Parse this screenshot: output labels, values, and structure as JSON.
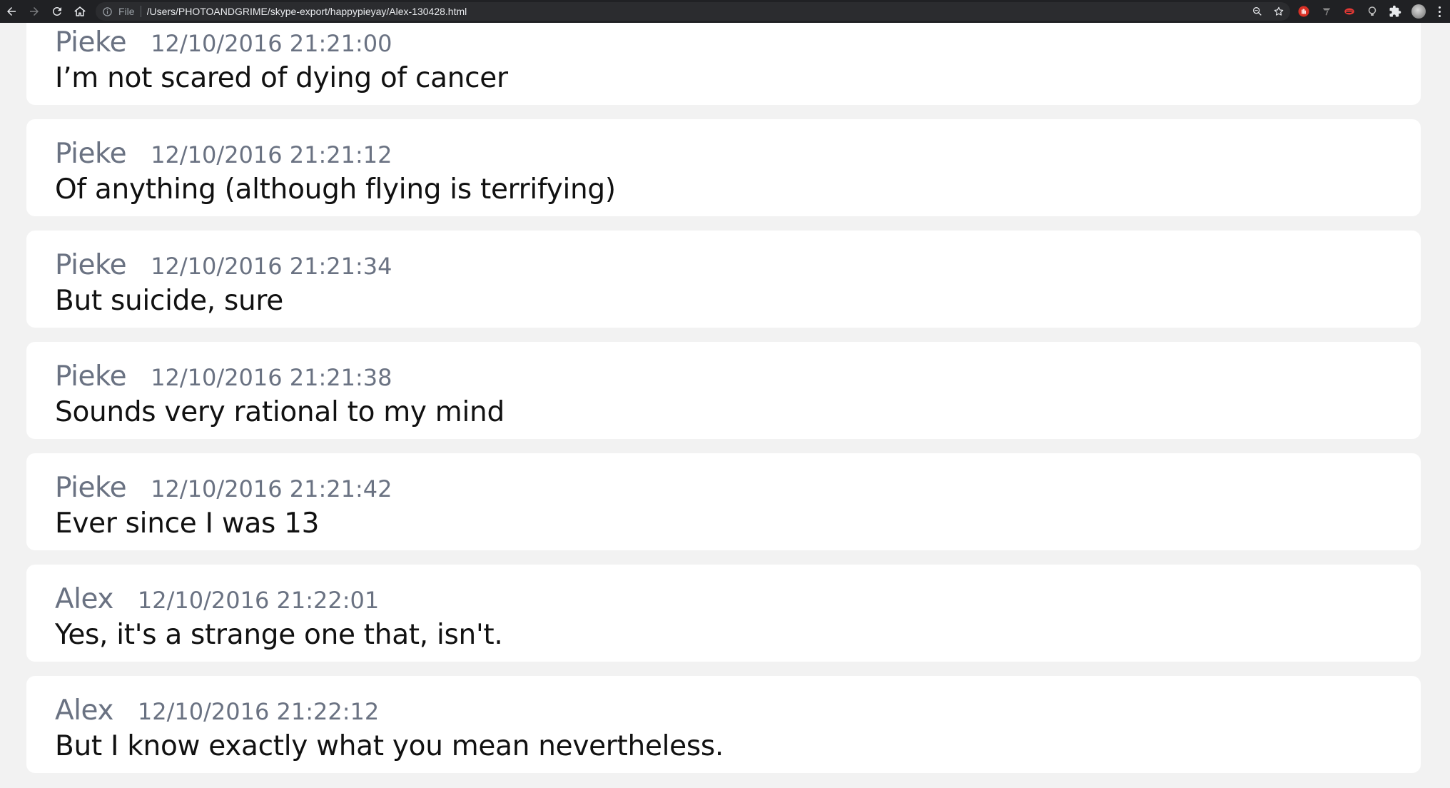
{
  "browser": {
    "scheme_label": "File",
    "url": "/Users/PHOTOANDGRIME/skype-export/happypieyay/Alex-130428.html",
    "icons": [
      "back-arrow-icon",
      "forward-arrow-icon",
      "reload-icon",
      "home-icon",
      "info-icon",
      "zoom-icon",
      "bookmark-star-icon",
      "extension-icons",
      "puzzle-icon",
      "profile-avatar",
      "menu-dots-icon"
    ]
  },
  "messages": [
    {
      "sender": "Pieke",
      "time": "12/10/2016 21:21:00",
      "text": "I’m not scared of dying of cancer"
    },
    {
      "sender": "Pieke",
      "time": "12/10/2016 21:21:12",
      "text": "Of anything (although flying is terrifying)"
    },
    {
      "sender": "Pieke",
      "time": "12/10/2016 21:21:34",
      "text": "But suicide, sure"
    },
    {
      "sender": "Pieke",
      "time": "12/10/2016 21:21:38",
      "text": "Sounds very rational to my mind"
    },
    {
      "sender": "Pieke",
      "time": "12/10/2016 21:21:42",
      "text": "Ever since I was 13"
    },
    {
      "sender": "Alex",
      "time": "12/10/2016 21:22:01",
      "text": "Yes, it's a strange one that, isn't."
    },
    {
      "sender": "Alex",
      "time": "12/10/2016 21:22:12",
      "text": "But I know exactly what you mean nevertheless."
    }
  ],
  "colors": {
    "page_bg": "#f2f2f2",
    "card_bg": "#ffffff",
    "meta_text": "#6a7282",
    "body_text": "#111111",
    "toolbar_bg": "#202124"
  }
}
